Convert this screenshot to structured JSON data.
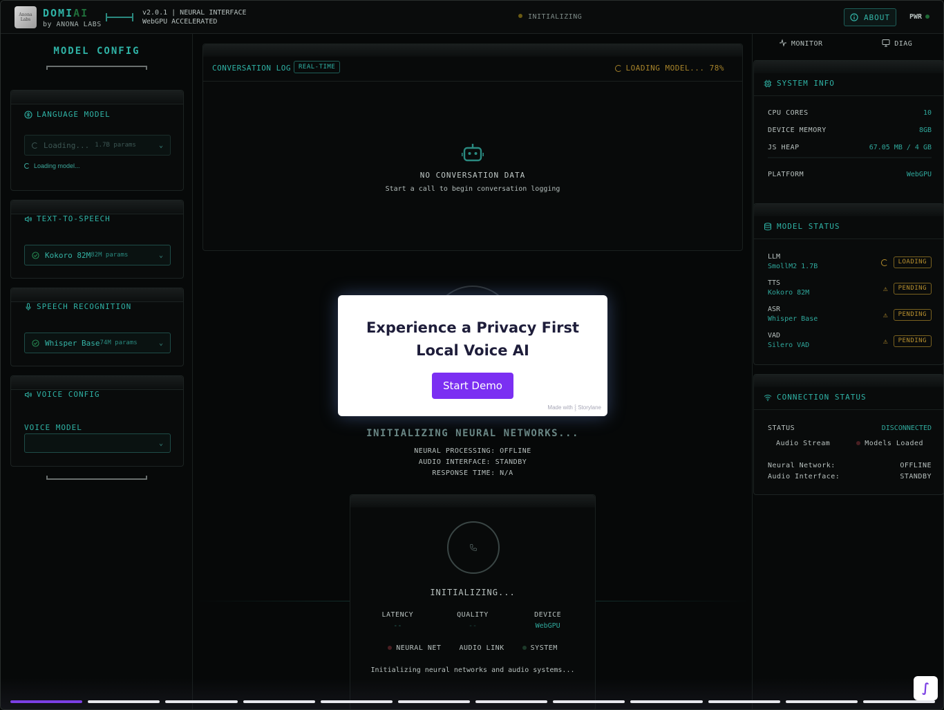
{
  "header": {
    "logo_text": "Anona Labs",
    "brand_main": "DOMI",
    "brand_accent": "AI",
    "brand_sub": "by ANONA LABS",
    "version_line1": "v2.0.1 | NEURAL INTERFACE",
    "version_line2": "WebGPU ACCELERATED",
    "status": "INITIALIZING",
    "about_label": "ABOUT",
    "pwr_label": "PWR"
  },
  "left": {
    "title": "MODEL CONFIG",
    "language_model": {
      "title": "LANGUAGE MODEL",
      "select_value": "Loading...",
      "select_params": "1.7B params",
      "note": "Loading model..."
    },
    "tts": {
      "title": "TEXT-TO-SPEECH",
      "select_value": "Kokoro 82M",
      "select_params": "82M params"
    },
    "asr": {
      "title": "SPEECH RECOGNITION",
      "select_value": "Whisper Base",
      "select_params": "74M params"
    },
    "voice": {
      "title": "VOICE CONFIG",
      "field_label": "VOICE MODEL",
      "field_value": ""
    }
  },
  "center": {
    "conversation": {
      "title": "CONVERSATION LOG",
      "badge": "REAL-TIME",
      "loading": "LOADING MODEL... 78%",
      "empty_title": "NO CONVERSATION DATA",
      "empty_sub": "Start a call to begin conversation logging"
    },
    "init_title": "INITIALIZING NEURAL NETWORKS...",
    "init_lines": [
      "NEURAL PROCESSING: OFFLINE",
      "AUDIO INTERFACE: STANDBY",
      "RESPONSE TIME: N/A"
    ],
    "call": {
      "status": "INITIALIZING...",
      "metrics": [
        {
          "label": "LATENCY",
          "value": "--"
        },
        {
          "label": "QUALITY",
          "value": "--"
        },
        {
          "label": "DEVICE",
          "value": "WebGPU"
        }
      ],
      "indicators": [
        "NEURAL NET",
        "AUDIO LINK",
        "SYSTEM"
      ],
      "note": "Initializing neural networks and audio systems..."
    }
  },
  "right": {
    "tabs": [
      "MONITOR",
      "DIAG"
    ],
    "system_info": {
      "title": "SYSTEM INFO",
      "rows": [
        {
          "k": "CPU CORES",
          "v": "10"
        },
        {
          "k": "DEVICE MEMORY",
          "v": "8GB"
        },
        {
          "k": "JS HEAP",
          "v": "67.05 MB / 4 GB"
        },
        {
          "k": "PLATFORM",
          "v": "WebGPU"
        }
      ]
    },
    "model_status": {
      "title": "MODEL STATUS",
      "items": [
        {
          "k": "LLM",
          "n": "SmollM2 1.7B",
          "status": "LOADING"
        },
        {
          "k": "TTS",
          "n": "Kokoro 82M",
          "status": "PENDING"
        },
        {
          "k": "ASR",
          "n": "Whisper Base",
          "status": "PENDING"
        },
        {
          "k": "VAD",
          "n": "Silero VAD",
          "status": "PENDING"
        }
      ]
    },
    "connection": {
      "title": "CONNECTION STATUS",
      "status_label": "STATUS",
      "status_value": "DISCONNECTED",
      "audio_stream": "Audio Stream",
      "models_loaded": "Models Loaded",
      "neural_label": "Neural Network:",
      "neural_value": "OFFLINE",
      "audio_label": "Audio Interface:",
      "audio_value": "STANDBY"
    }
  },
  "modal": {
    "heading_line1": "Experience a Privacy First",
    "heading_line2": "Local Voice AI",
    "button": "Start Demo",
    "made_with": "Made with ⸾ Storylane"
  },
  "tour": {
    "steps_total": 12,
    "current_step": 1
  },
  "colors": {
    "accent": "#2fb3a6",
    "warning": "#b8902e",
    "cta": "#7b2ff2"
  }
}
